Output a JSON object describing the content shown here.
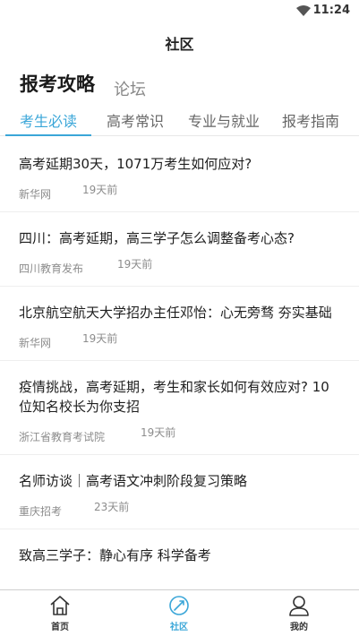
{
  "status_bar": {
    "time": "11:24"
  },
  "nav": {
    "title": "社区"
  },
  "section_tabs": {
    "active": "报考攻略",
    "other": "论坛"
  },
  "sub_tabs": [
    {
      "label": "考生必读",
      "active": true
    },
    {
      "label": "高考常识",
      "active": false
    },
    {
      "label": "专业与就业",
      "active": false
    },
    {
      "label": "报考指南",
      "active": false
    }
  ],
  "articles": [
    {
      "title": "高考延期30天，1071万考生如何应对?",
      "source": "新华网",
      "time": "19天前"
    },
    {
      "title": "四川：高考延期，高三学子怎么调整备考心态?",
      "source": "四川教育发布",
      "time": "19天前"
    },
    {
      "title": "北京航空航天大学招办主任邓怡：心无旁骛 夯实基础",
      "source": "新华网",
      "time": "19天前"
    },
    {
      "title": "疫情挑战，高考延期，考生和家长如何有效应对? 10位知名校长为你支招",
      "source": "浙江省教育考试院",
      "time": "19天前"
    },
    {
      "title": "名师访谈｜高考语文冲刺阶段复习策略",
      "source": "重庆招考",
      "time": "23天前"
    },
    {
      "title": "致高三学子：静心有序 科学备考",
      "source": "",
      "time": ""
    }
  ],
  "bottom_nav": {
    "home": "首页",
    "community": "社区",
    "mine": "我的"
  },
  "colors": {
    "accent": "#3aa6d8"
  }
}
